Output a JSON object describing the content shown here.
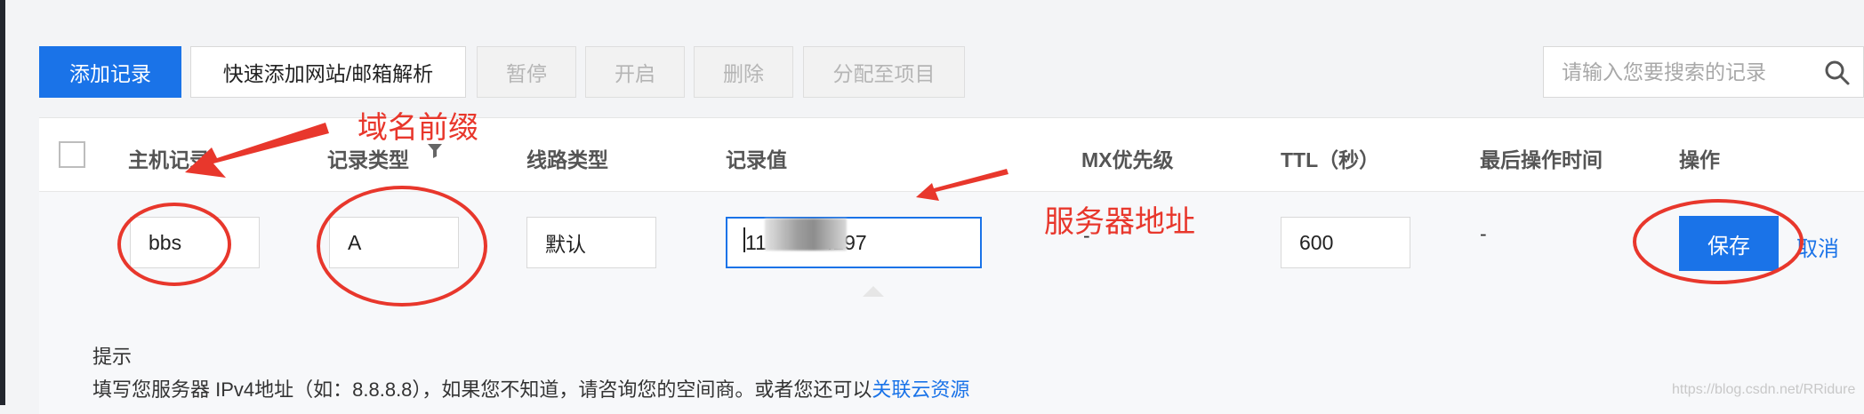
{
  "toolbar": {
    "add_record": "添加记录",
    "quick_add": "快速添加网站/邮箱解析",
    "pause": "暂停",
    "enable": "开启",
    "delete": "删除",
    "assign_project": "分配至项目"
  },
  "search": {
    "placeholder": "请输入您要搜索的记录",
    "icon": "search-icon"
  },
  "table": {
    "headers": {
      "host": "主机记录",
      "type": "记录类型",
      "line": "线路类型",
      "value": "记录值",
      "mx": "MX优先级",
      "ttl": "TTL（秒）",
      "last_op": "最后操作时间",
      "actions": "操作"
    },
    "edit_row": {
      "host": "bbs",
      "type": "A",
      "line": "默认",
      "value_prefix": "11",
      "value_suffix": ".197",
      "mx": "-",
      "ttl": "600",
      "last_op": "-",
      "save": "保存",
      "cancel": "取消"
    }
  },
  "tip": {
    "title": "提示",
    "text": "填写您服务器 IPv4地址（如：8.8.8.8），如果您不知道，请咨询您的空间商。或者您还可以",
    "link": "关联云资源"
  },
  "annotations": {
    "domain_prefix": "域名前缀",
    "server_address": "服务器地址",
    "color": "#e8372c"
  },
  "watermark": "https://blog.csdn.net/RRidure"
}
